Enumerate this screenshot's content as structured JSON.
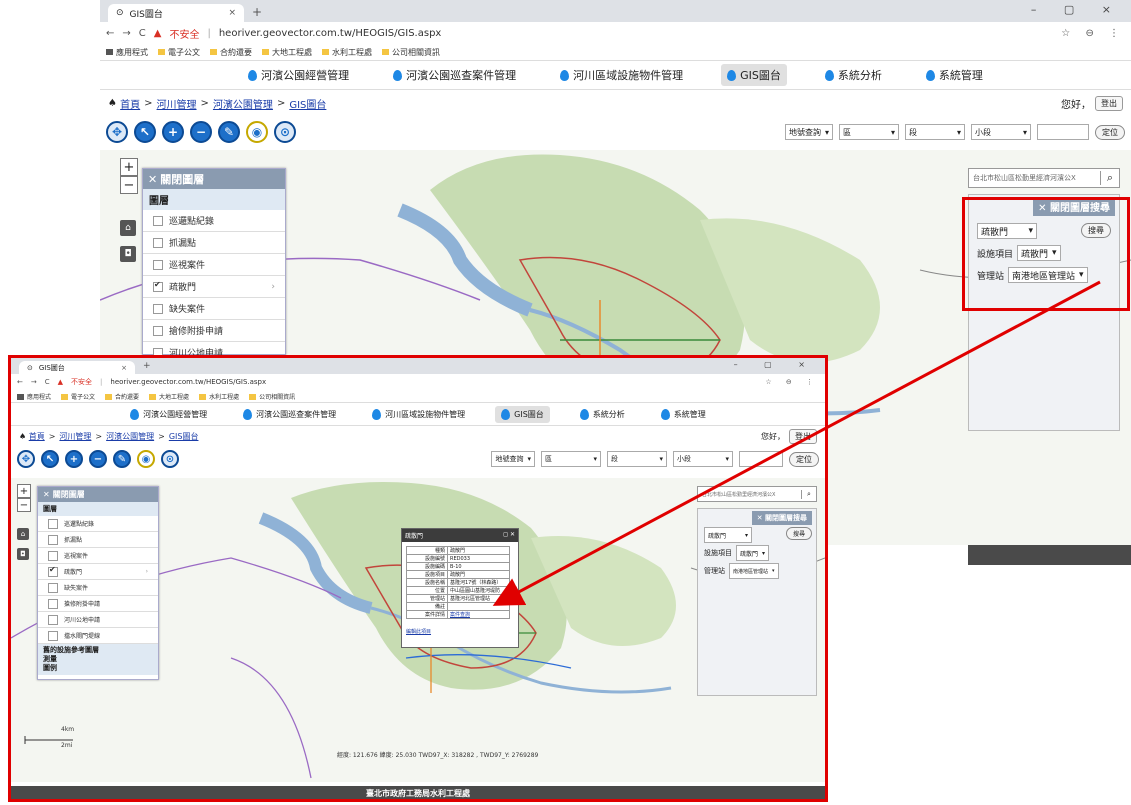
{
  "browser": {
    "tab_title": "GIS圖台",
    "tab_close": "×",
    "new_tab": "+",
    "window_controls": "–  ▢  ×",
    "nav": {
      "back": "←",
      "forward": "→",
      "reload": "C"
    },
    "security_label": "不安全",
    "url": "heoriver.geovector.com.tw/HEOGIS/GIS.aspx",
    "right_icons": "☆ ⊖ ⋮",
    "bookmarks": [
      "應用程式",
      "電子公文",
      "合約還要",
      "大地工程處",
      "水利工程處",
      "公司相關資訊"
    ]
  },
  "nav": {
    "items": [
      "河濱公園經營管理",
      "河濱公園巡查案件管理",
      "河川區域設施物件管理",
      "GIS圖台",
      "系統分析",
      "系統管理"
    ],
    "active_index": 3
  },
  "breadcrumb": {
    "items": [
      "首頁",
      "河川管理",
      "河濱公園管理",
      "GIS圖台"
    ],
    "separator": ">"
  },
  "user": {
    "greeting": "您好，",
    "logout_label": "登出"
  },
  "toolbar": {
    "tools": [
      {
        "icon": "pan-icon",
        "glyph": "✥"
      },
      {
        "icon": "select-arrow-icon",
        "glyph": "↖"
      },
      {
        "icon": "zoom-in-icon",
        "glyph": "+"
      },
      {
        "icon": "zoom-out-icon",
        "glyph": "−"
      },
      {
        "icon": "clear-icon",
        "glyph": "✎"
      },
      {
        "icon": "eye-icon",
        "glyph": "◉"
      },
      {
        "icon": "full-extent-icon",
        "glyph": "⊙"
      }
    ],
    "locate": {
      "mode": "地號查詢",
      "district": "區",
      "section": "段",
      "subsection": "小段",
      "button": "定位"
    }
  },
  "map": {
    "zoom_in": "+",
    "zoom_out": "−",
    "home_glyph": "⌂",
    "camera_glyph": "◘",
    "search_text": "台北市松山區松勤里經濟河濱公X",
    "search_clear": "X",
    "search_glyph": "⌕",
    "coords": "經度: 121.676  緯度: 25.030    TWD97_X: 318282 , TWD97_Y: 2769289",
    "scale_top": "4km",
    "scale_bottom": "2mi"
  },
  "layer_panel": {
    "close_label": "關閉圖層",
    "header": "圖層",
    "items": [
      {
        "label": "巡邏點紀錄",
        "checked": false
      },
      {
        "label": "抓漏點",
        "checked": false
      },
      {
        "label": "巡視案件",
        "checked": false
      },
      {
        "label": "疏散門",
        "checked": true
      },
      {
        "label": "缺失案件",
        "checked": false
      },
      {
        "label": "搶修附掛申請",
        "checked": false
      },
      {
        "label": "河川公地申請",
        "checked": false
      },
      {
        "label": "擋水閘門堤線",
        "checked": false
      }
    ],
    "footer": [
      "舊的設施參考圖層",
      "測量",
      "圖例"
    ]
  },
  "right_panel": {
    "close_label": "關閉圖層搜尋",
    "type_select": "疏散門",
    "search_button": "搜尋",
    "facility_label": "設施項目",
    "facility_value": "疏散門",
    "station_label": "管理站",
    "station_value": "南港地區管理站"
  },
  "popup": {
    "title": "疏散門",
    "controls": "◻ ✕",
    "rows": [
      [
        "種類",
        "疏散門"
      ],
      [
        "設施編號",
        "RED033"
      ],
      [
        "設施編碼",
        "B-10"
      ],
      [
        "設施項目",
        "疏散門"
      ],
      [
        "設施名稱",
        "基隆河17號（林森路）"
      ],
      [
        "位置",
        "中山區圓山基隆河堤防"
      ],
      [
        "管理站",
        "基隆河北區管理站"
      ],
      [
        "備註",
        ""
      ],
      [
        "案件詳情",
        "案件查詢"
      ]
    ],
    "link": "編輯此項目"
  },
  "footer": {
    "text": "臺北市政府工務局水利工程處"
  }
}
